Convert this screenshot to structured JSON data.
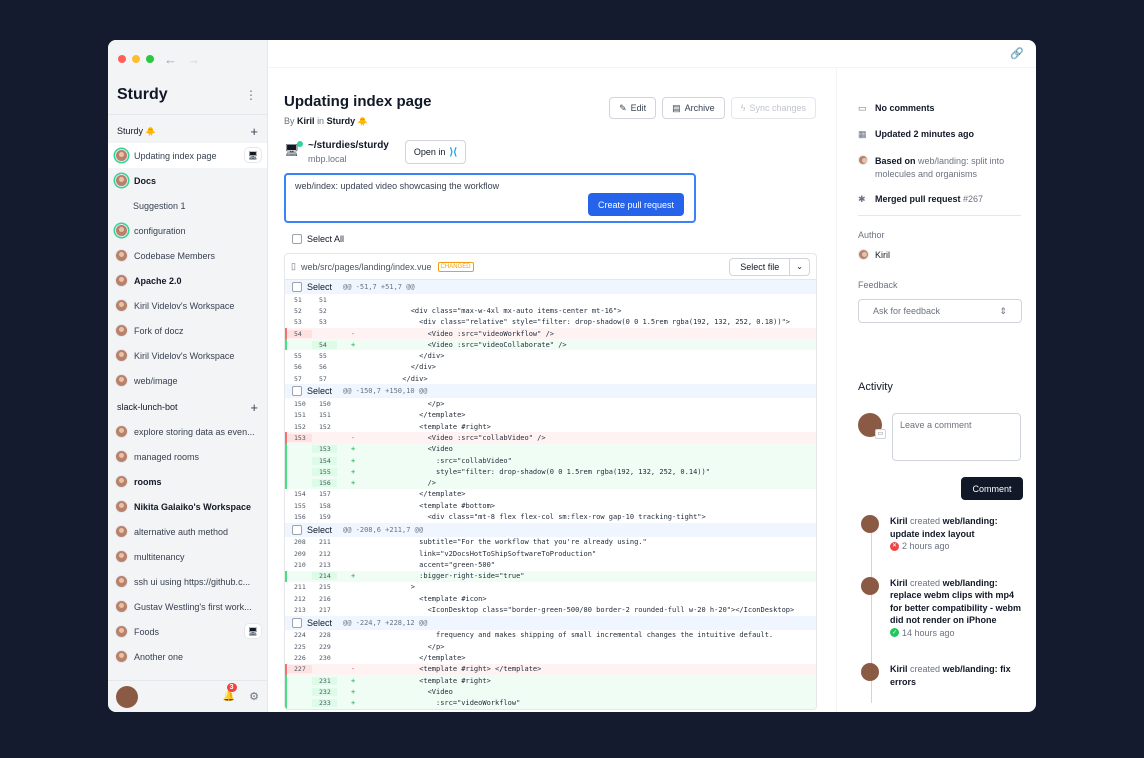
{
  "sidebar": {
    "app_title": "Sturdy",
    "groups": [
      {
        "name": "Sturdy",
        "emoji": "🐥"
      },
      {
        "name": "slack-lunch-bot"
      }
    ],
    "items_sturdy": [
      {
        "label": "Updating index page",
        "active": true,
        "icon": "workspace-icon"
      },
      {
        "label": "Docs",
        "bold": true
      },
      {
        "label": "Suggestion 1"
      },
      {
        "label": "configuration"
      },
      {
        "label": "Codebase Members"
      },
      {
        "label": "Apache 2.0",
        "bold": true
      },
      {
        "label": "Kiril Videlov's Workspace"
      },
      {
        "label": "Fork of docz"
      },
      {
        "label": "Kiril Videlov's Workspace"
      },
      {
        "label": "web/image"
      }
    ],
    "items_slack": [
      {
        "label": "explore storing data as even..."
      },
      {
        "label": "managed rooms"
      },
      {
        "label": "rooms",
        "bold": true
      },
      {
        "label": "Nikita Galaiko's Workspace",
        "bold": true
      },
      {
        "label": "alternative auth method"
      },
      {
        "label": "multitenancy"
      },
      {
        "label": "ssh ui using https://github.c..."
      },
      {
        "label": "Gustav Westling's first work..."
      },
      {
        "label": "Foods"
      },
      {
        "label": "Another one"
      }
    ],
    "notification_count": "3"
  },
  "header": {
    "title": "Updating index page",
    "by": "By",
    "author": "Kiril",
    "in": "in",
    "codebase": "Sturdy",
    "codebase_emoji": "🐥",
    "edit_label": "Edit",
    "archive_label": "Archive",
    "sync_label": "Sync changes"
  },
  "workspace": {
    "path": "~/sturdies/sturdy",
    "host": "mbp.local",
    "open_in_label": "Open in"
  },
  "commit": {
    "message": "web/index: updated video showcasing the workflow",
    "create_pr_label": "Create pull request"
  },
  "select_all_label": "Select All",
  "diff": {
    "file": "web/src/pages/landing/index.vue",
    "status": "CHANGED",
    "select_file_label": "Select file",
    "hunk_select_label": "Select",
    "hunks": [
      {
        "range": "@@ -51,7 +51,7 @@",
        "lines": [
          {
            "t": "ctx",
            "o": "51",
            "n": "51",
            "c": ""
          },
          {
            "t": "ctx",
            "o": "52",
            "n": "52",
            "c": "        <div class=\"max-w-4xl mx-auto items-center mt-16\">"
          },
          {
            "t": "ctx",
            "o": "53",
            "n": "53",
            "c": "          <div class=\"relative\" style=\"filter: drop-shadow(0 0 1.5rem rgba(192, 132, 252, 0.18))\">"
          },
          {
            "t": "del",
            "o": "54",
            "n": "",
            "c": "            <Video :src=\"videoWorkflow\" />"
          },
          {
            "t": "add",
            "o": "",
            "n": "54",
            "c": "            <Video :src=\"videoCollaborate\" />"
          },
          {
            "t": "ctx",
            "o": "55",
            "n": "55",
            "c": "          </div>"
          },
          {
            "t": "ctx",
            "o": "56",
            "n": "56",
            "c": "        </div>"
          },
          {
            "t": "ctx",
            "o": "57",
            "n": "57",
            "c": "      </div>"
          }
        ]
      },
      {
        "range": "@@ -150,7 +150,10 @@",
        "lines": [
          {
            "t": "ctx",
            "o": "150",
            "n": "150",
            "c": "            </p>"
          },
          {
            "t": "ctx",
            "o": "151",
            "n": "151",
            "c": "          </template>"
          },
          {
            "t": "ctx",
            "o": "152",
            "n": "152",
            "c": "          <template #right>"
          },
          {
            "t": "del",
            "o": "153",
            "n": "",
            "c": "            <Video :src=\"collabVideo\" />"
          },
          {
            "t": "add",
            "o": "",
            "n": "153",
            "c": "            <Video"
          },
          {
            "t": "add",
            "o": "",
            "n": "154",
            "c": "              :src=\"collabVideo\""
          },
          {
            "t": "add",
            "o": "",
            "n": "155",
            "c": "              style=\"filter: drop-shadow(0 0 1.5rem rgba(192, 132, 252, 0.14))\""
          },
          {
            "t": "add",
            "o": "",
            "n": "156",
            "c": "            />"
          },
          {
            "t": "ctx",
            "o": "154",
            "n": "157",
            "c": "          </template>"
          },
          {
            "t": "ctx",
            "o": "155",
            "n": "158",
            "c": "          <template #bottom>"
          },
          {
            "t": "ctx",
            "o": "156",
            "n": "159",
            "c": "            <div class=\"mt-8 flex flex-col sm:flex-row gap-10 tracking-tight\">"
          }
        ]
      },
      {
        "range": "@@ -208,6 +211,7 @@",
        "lines": [
          {
            "t": "ctx",
            "o": "208",
            "n": "211",
            "c": "          subtitle=\"For the workflow that you're already using.\""
          },
          {
            "t": "ctx",
            "o": "209",
            "n": "212",
            "c": "          link=\"v2DocsHotToShipSoftwareToProduction\""
          },
          {
            "t": "ctx",
            "o": "210",
            "n": "213",
            "c": "          accent=\"green-500\""
          },
          {
            "t": "add",
            "o": "",
            "n": "214",
            "c": "          :bigger-right-side=\"true\""
          },
          {
            "t": "ctx",
            "o": "211",
            "n": "215",
            "c": "        >"
          },
          {
            "t": "ctx",
            "o": "212",
            "n": "216",
            "c": "          <template #icon>"
          },
          {
            "t": "ctx",
            "o": "213",
            "n": "217",
            "c": "            <IconDesktop class=\"border-green-500/80 border-2 rounded-full w-20 h-20\"></IconDesktop>"
          }
        ]
      },
      {
        "range": "@@ -224,7 +228,12 @@",
        "lines": [
          {
            "t": "ctx",
            "o": "224",
            "n": "228",
            "c": "              frequency and makes shipping of small incremental changes the intuitive default."
          },
          {
            "t": "ctx",
            "o": "225",
            "n": "229",
            "c": "            </p>"
          },
          {
            "t": "ctx",
            "o": "226",
            "n": "230",
            "c": "          </template>"
          },
          {
            "t": "del",
            "o": "227",
            "n": "",
            "c": "          <template #right> </template>"
          },
          {
            "t": "add",
            "o": "",
            "n": "231",
            "c": "          <template #right>"
          },
          {
            "t": "add",
            "o": "",
            "n": "232",
            "c": "            <Video"
          },
          {
            "t": "add",
            "o": "",
            "n": "233",
            "c": "              :src=\"videoWorkflow\""
          }
        ]
      }
    ]
  },
  "meta": {
    "comments": "No comments",
    "updated": "Updated 2 minutes ago",
    "based_on_prefix": "Based on",
    "based_on": "web/landing: split into molecules and organisms",
    "merged": "Merged pull request",
    "pr_number": "#267"
  },
  "author_label": "Author",
  "author_name": "Kiril",
  "feedback_label": "Feedback",
  "feedback_placeholder": "Ask for feedback",
  "activity": {
    "title": "Activity",
    "comment_placeholder": "Leave a comment",
    "comment_button": "Comment",
    "items": [
      {
        "who": "Kiril",
        "verb": "created",
        "what": "web/landing: update index layout",
        "time": "2 hours ago",
        "status": "fail"
      },
      {
        "who": "Kiril",
        "verb": "created",
        "what": "web/landing: replace webm clips with mp4 for better compatibility - webm did not render on iPhone",
        "time": "14 hours ago",
        "status": "ok"
      },
      {
        "who": "Kiril",
        "verb": "created",
        "what": "web/landing: fix errors",
        "time": "",
        "status": ""
      }
    ]
  },
  "colors": {
    "accent": "#2563eb",
    "success": "#22c55e",
    "danger": "#ef4444",
    "changed": "#f59e0b"
  }
}
